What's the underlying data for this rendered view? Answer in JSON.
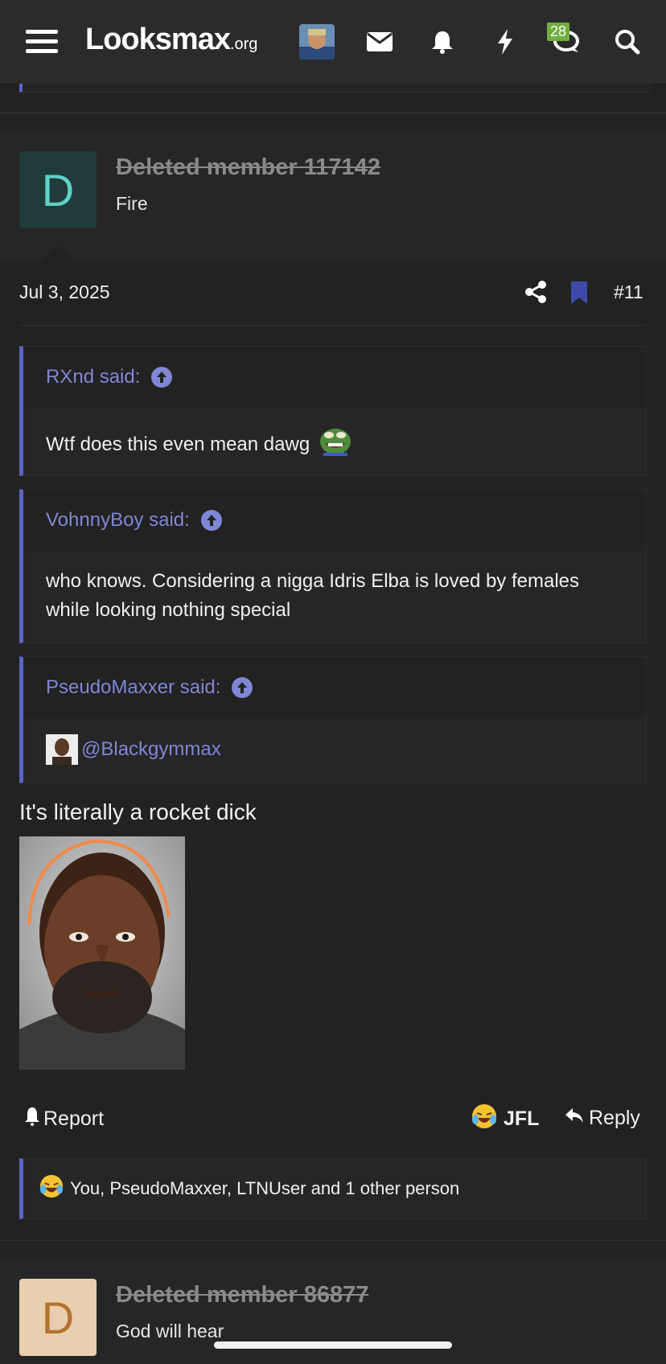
{
  "header": {
    "logo_main": "Looksmax",
    "logo_suffix": ".org",
    "notification_count": "28",
    "menu_icon": "hamburger-icon",
    "mail_icon": "envelope-icon",
    "alerts_icon": "bell-icon",
    "bolt_icon": "bolt-icon",
    "chat_icon": "chat-icon",
    "search_icon": "search-icon"
  },
  "post": {
    "author": "Deleted member 117142",
    "author_title": "Fire",
    "avatar_letter": "D",
    "date": "Jul 3, 2025",
    "number": "#11",
    "quotes": [
      {
        "author": "RXnd said:",
        "text": "Wtf does this even mean dawg"
      },
      {
        "author": "VohnnyBoy said:",
        "text": "who knows. Considering a nigga Idris Elba is loved by females while looking nothing special"
      },
      {
        "author": "PseudoMaxxer said:",
        "text": "@Blackgymmax"
      }
    ],
    "body_text": "It's literally a rocket dick",
    "actions": {
      "report": "Report",
      "reaction": "JFL",
      "reply": "Reply"
    },
    "reactions_summary": "You, PseudoMaxxer, LTNUser and 1 other person"
  },
  "next_post": {
    "author": "Deleted member 86877",
    "author_title": "God will hear",
    "avatar_letter": "D"
  },
  "colors": {
    "accent": "#5b64c4",
    "quote_link": "#7f87d6",
    "avatar1_bg": "#1f3b3a",
    "avatar1_fg": "#5fd1c9",
    "avatar2_bg": "#e8cfae",
    "avatar2_fg": "#b4732f"
  }
}
